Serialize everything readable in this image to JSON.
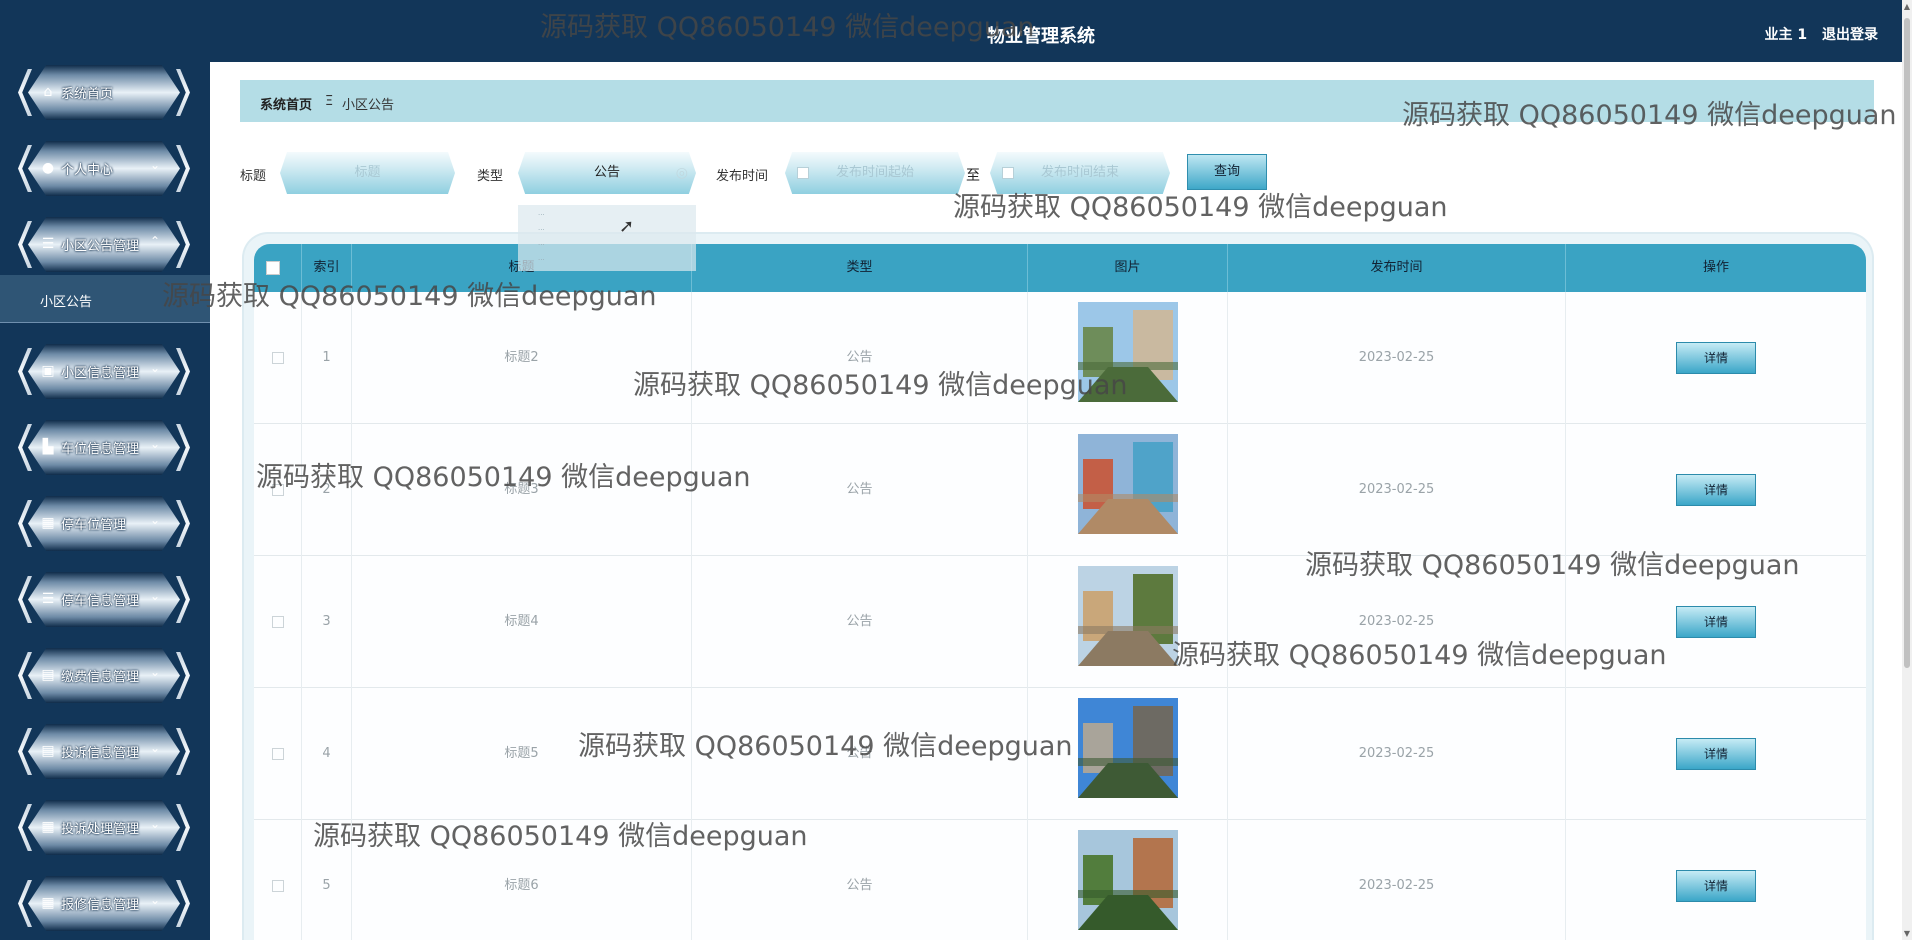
{
  "header": {
    "title": "物业管理系统",
    "user": "业主 1",
    "logout": "退出登录"
  },
  "sidebar": {
    "items": [
      {
        "label": "系统首页",
        "icon": "home-icon",
        "glyph": "⌂",
        "chevron": ""
      },
      {
        "label": "个人中心",
        "icon": "user-icon",
        "glyph": "●",
        "chevron": "⌄"
      },
      {
        "label": "小区公告管理",
        "icon": "list-icon",
        "glyph": "☰",
        "chevron": "⌃"
      },
      {
        "label": "小区信息管理",
        "icon": "briefcase-icon",
        "glyph": "▣",
        "chevron": "⌄"
      },
      {
        "label": "车位信息管理",
        "icon": "car-icon",
        "glyph": "▙",
        "chevron": "⌄"
      },
      {
        "label": "停车位管理",
        "icon": "grid-icon",
        "glyph": "▦",
        "chevron": "⌄"
      },
      {
        "label": "停车信息管理",
        "icon": "sliders-icon",
        "glyph": "☰",
        "chevron": "⌄"
      },
      {
        "label": "缴费信息管理",
        "icon": "clipboard-x-icon",
        "glyph": "▤",
        "chevron": "⌄"
      },
      {
        "label": "投诉信息管理",
        "icon": "clipboard-icon",
        "glyph": "▤",
        "chevron": "⌄"
      },
      {
        "label": "投诉处理管理",
        "icon": "grid-icon",
        "glyph": "▦",
        "chevron": "⌄"
      },
      {
        "label": "报修信息管理",
        "icon": "grid-icon",
        "glyph": "▦",
        "chevron": "⌄"
      }
    ],
    "active_sub": "小区公告"
  },
  "breadcrumb": {
    "home": "系统首页",
    "separator": "Ξ",
    "current": "小区公告"
  },
  "search": {
    "title_label": "标题",
    "title_placeholder": "标题",
    "type_label": "类型",
    "type_value": "公告",
    "time_label": "发布时间",
    "start_placeholder": "发布时间起始",
    "to_label": "至",
    "end_placeholder": "发布时间结束",
    "button": "查询"
  },
  "table": {
    "headers": [
      "索引",
      "标题",
      "类型",
      "图片",
      "发布时间",
      "操作"
    ],
    "rows": [
      {
        "index": "1",
        "title": "标题2",
        "type": "公告",
        "date": "2023-02-25",
        "action": "详情"
      },
      {
        "index": "2",
        "title": "标题3",
        "type": "公告",
        "date": "2023-02-25",
        "action": "详情"
      },
      {
        "index": "3",
        "title": "标题4",
        "type": "公告",
        "date": "2023-02-25",
        "action": "详情"
      },
      {
        "index": "4",
        "title": "标题5",
        "type": "公告",
        "date": "2023-02-25",
        "action": "详情"
      },
      {
        "index": "5",
        "title": "标题6",
        "type": "公告",
        "date": "2023-02-25",
        "action": "详情"
      }
    ]
  },
  "watermark": "源码获取 QQ86050149 微信deepguan"
}
